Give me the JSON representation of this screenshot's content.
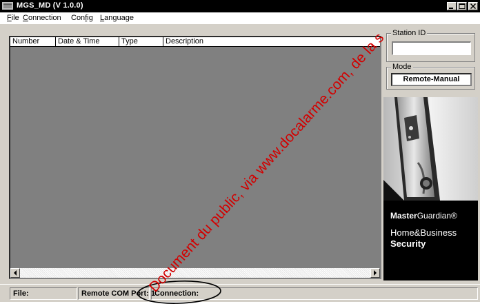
{
  "window": {
    "title": "MGS_MD (V 1.0.0)"
  },
  "menu": {
    "file_key": "F",
    "file_rest": "ile",
    "connection_key": "C",
    "connection_rest": "onnection",
    "config_pre": "Con",
    "config_key": "f",
    "config_rest": "ig",
    "language_key": "L",
    "language_rest": "anguage"
  },
  "list": {
    "columns": [
      "Number",
      "Date & Time",
      "Type",
      "Description"
    ],
    "rows": []
  },
  "station": {
    "label": "Station ID",
    "value": ""
  },
  "mode": {
    "label": "Mode",
    "value": "Remote-Manual"
  },
  "product": {
    "brand_bold": "Master",
    "brand_rest": "Guardian®",
    "tag_line1": "Home&Business",
    "tag_line2": "Security"
  },
  "status": {
    "file": "File:",
    "port": "Remote COM Port: 1",
    "connection": "Connection:"
  },
  "watermark": "Document du public, via www.docalarme.com, de la s",
  "colors": {
    "title_bar": "#000000",
    "list_background": "#808080",
    "watermark": "#d20000"
  },
  "icons": [
    "app-icon",
    "minimize-icon",
    "maximize-icon",
    "close-icon",
    "arrow-left-icon",
    "arrow-right-icon"
  ]
}
